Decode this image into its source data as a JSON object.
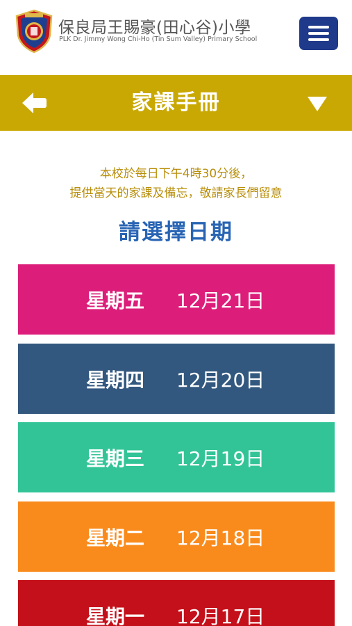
{
  "header": {
    "school_name_zh": "保良局王賜豪(田心谷)小學",
    "school_name_en": "PLK Dr. Jimmy Wong Chi-Ho (Tin Sum Valley) Primary School",
    "menu_icon": "hamburger-menu-icon"
  },
  "titlebar": {
    "title": "家課手冊",
    "back_icon": "arrow-left-icon",
    "dropdown_icon": "triangle-down-icon",
    "color": "#c9a804"
  },
  "notice": {
    "line1": "本校於每日下午4時30分後，",
    "line2": "提供當天的家課及備忘，敬請家長們留意"
  },
  "choose_date_label": "請選擇日期",
  "days": [
    {
      "weekday": "星期五",
      "date": "12月21日",
      "color": "#dc1e7a"
    },
    {
      "weekday": "星期四",
      "date": "12月20日",
      "color": "#33587f"
    },
    {
      "weekday": "星期三",
      "date": "12月19日",
      "color": "#32c497"
    },
    {
      "weekday": "星期二",
      "date": "12月18日",
      "color": "#f98b1c"
    },
    {
      "weekday": "星期一",
      "date": "12月17日",
      "color": "#c4101a"
    }
  ],
  "colors": {
    "menu_button": "#1f3a8a",
    "notice_text": "#b88e0a",
    "choose_text": "#2864b4"
  }
}
